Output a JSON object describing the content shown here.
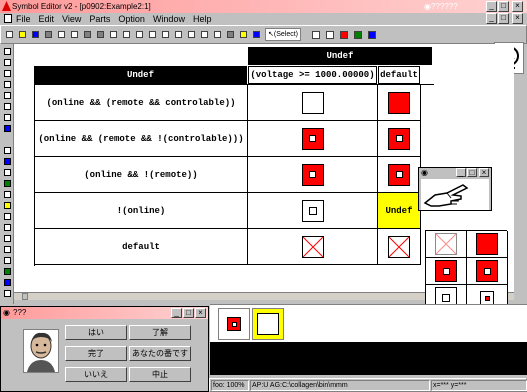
{
  "app": {
    "title": "Symbol Editor v2 - [p0902:Example2:1]",
    "user_tag": "??????"
  },
  "menu": [
    "File",
    "Edit",
    "View",
    "Parts",
    "Option",
    "Window",
    "Help"
  ],
  "toolbar": {
    "select_label": "(Select)"
  },
  "table": {
    "col_headers": [
      "(voltage >= 1000.00000)",
      "default"
    ],
    "group_header": "Undef",
    "corner_label": "Undef",
    "rows": [
      {
        "label": "(online && (remote && controlable))",
        "cells": [
          "white",
          "red"
        ]
      },
      {
        "label": "(online && (remote && !(controlable)))",
        "cells": [
          "redsq",
          "redsq"
        ]
      },
      {
        "label": "(online && !(remote))",
        "cells": [
          "redsq",
          "redsq"
        ]
      },
      {
        "label": "!(online)",
        "cells": [
          "wsq",
          "undef"
        ]
      },
      {
        "label": "default",
        "cells": [
          "x",
          "x"
        ]
      }
    ],
    "undef_cell_text": "Undef"
  },
  "palette": {
    "undef_label": "Undef"
  },
  "chat": {
    "title": "???",
    "buttons": [
      "はい",
      "了解",
      "完了",
      "あなたの番です",
      "いいえ",
      "中止"
    ]
  },
  "statusbar": {
    "left": "foo: 100%",
    "path": "AP:U AG:C:\\collagen\\bin\\mmm",
    "coords": "x=*** y=***"
  },
  "colors": {
    "title_active": "#000080",
    "highlight": "#ffff00",
    "symbol_red": "#ff0000"
  }
}
